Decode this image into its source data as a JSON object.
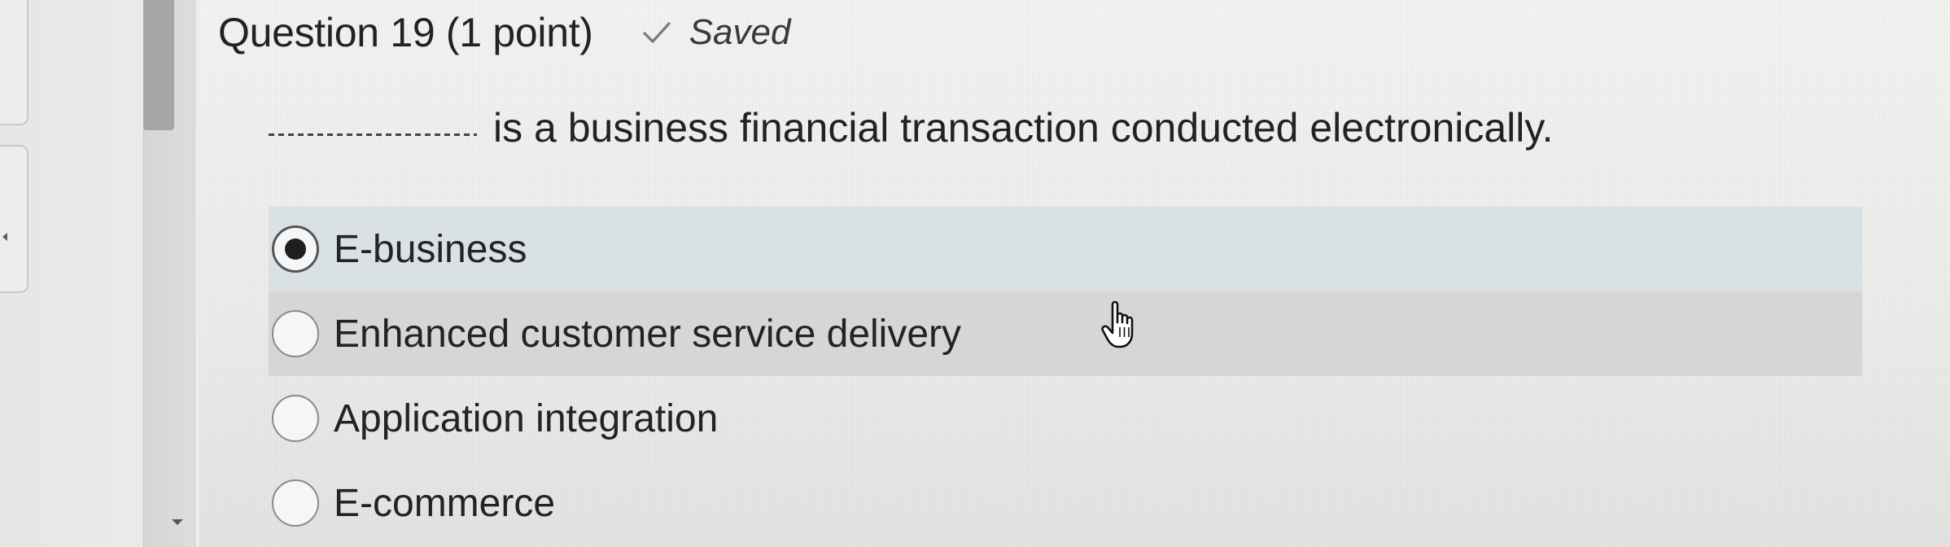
{
  "header": {
    "title": "Question 19 (1 point)",
    "saved_label": "Saved"
  },
  "question": {
    "blank": "___________",
    "text": "is a business financial transaction conducted electronically."
  },
  "options": [
    {
      "label": "E-business",
      "selected": true
    },
    {
      "label": "Enhanced customer service delivery",
      "selected": false
    },
    {
      "label": "Application integration",
      "selected": false
    },
    {
      "label": "E-commerce",
      "selected": false
    }
  ],
  "icons": {
    "saved": "checkmark-icon",
    "cursor": "hand-pointer-icon"
  },
  "colors": {
    "selected_row": "#d9e1e5",
    "hover_row": "#d6d6d5",
    "scroll_thumb": "#a6a6a4"
  }
}
